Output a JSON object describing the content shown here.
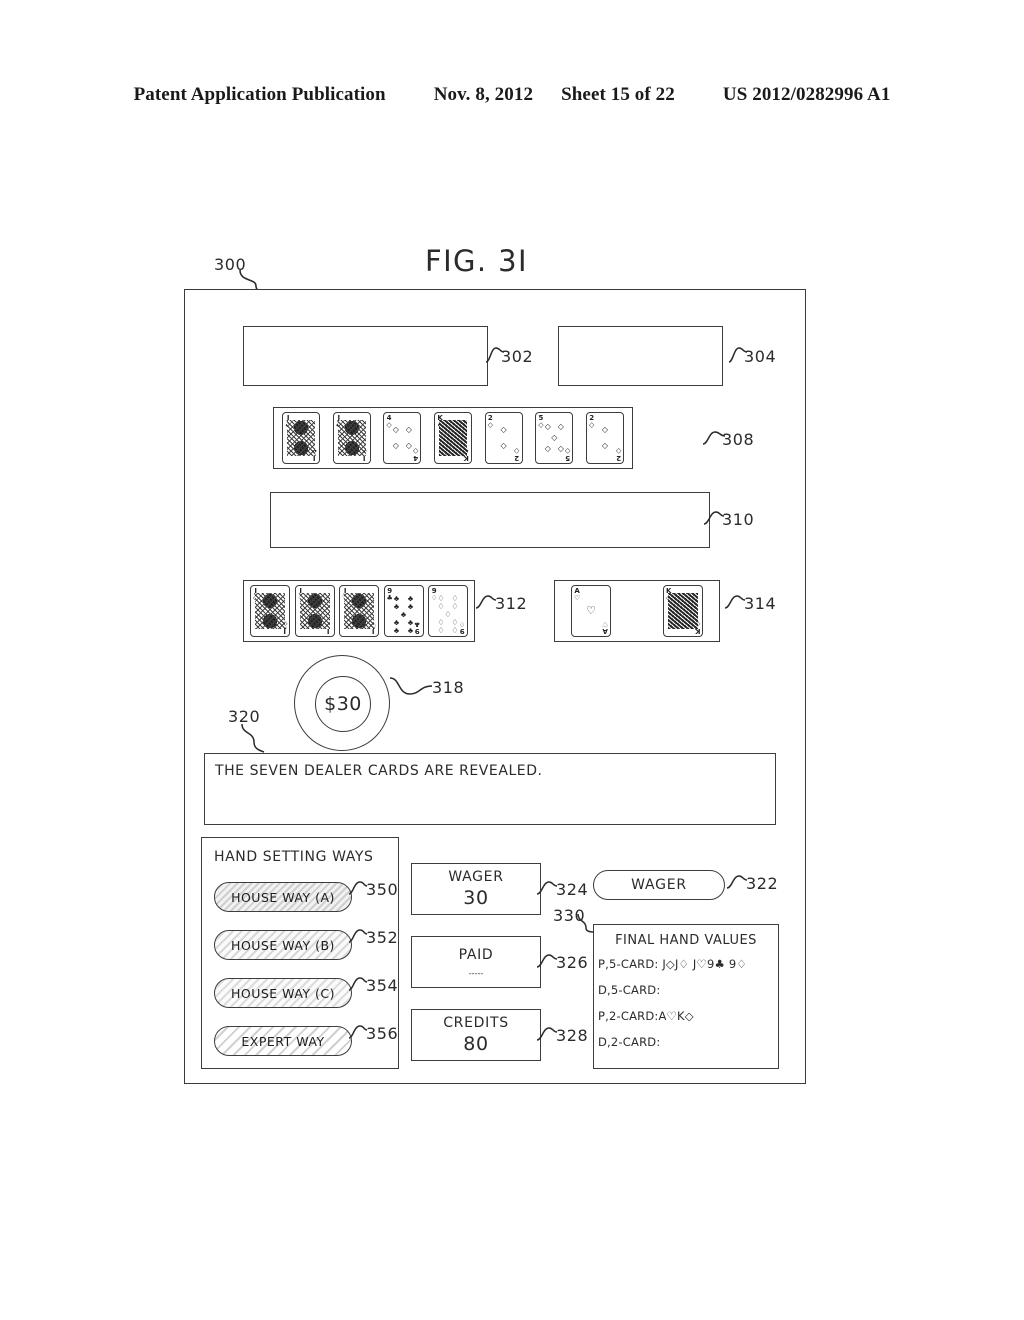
{
  "header": {
    "publication": "Patent Application Publication",
    "date": "Nov. 8, 2012",
    "sheet": "Sheet 15 of 22",
    "number": "US 2012/0282996 A1"
  },
  "figure": {
    "title": "FIG. 3I",
    "device_ref": "300"
  },
  "refs": {
    "top_left_box": "302",
    "top_right_box": "304",
    "dealer_card_row": "308",
    "mid_box": "310",
    "player_hand_row": "312",
    "player_two_card_row": "314",
    "bet_chip": "318",
    "message_box": "320",
    "wager_button": "322",
    "wager_meter": "324",
    "paid_meter": "326",
    "credits_meter": "328",
    "final_hand_values": "330",
    "house_way_a": "350",
    "house_way_b": "352",
    "house_way_c": "354",
    "expert_way": "356"
  },
  "chip": {
    "amount": "$30"
  },
  "message": {
    "text": "THE SEVEN DEALER CARDS ARE REVEALED."
  },
  "ways": {
    "title": "HAND SETTING WAYS",
    "buttons": [
      {
        "label": "HOUSE WAY (A)"
      },
      {
        "label": "HOUSE WAY (B)"
      },
      {
        "label": "HOUSE WAY (C)"
      },
      {
        "label": "EXPERT WAY"
      }
    ]
  },
  "meters": {
    "wager": {
      "label": "WAGER",
      "value": "30"
    },
    "paid": {
      "label": "PAID",
      "value": "-----"
    },
    "credits": {
      "label": "CREDITS",
      "value": "80"
    }
  },
  "wager_button": {
    "label": "WAGER"
  },
  "final_hand_values": {
    "title": "FINAL HAND VALUES",
    "rows": [
      "P,5-CARD: J◇J♢ J♡9♣ 9♢",
      "D,5-CARD:",
      "P,2-CARD:A♡K◇",
      "D,2-CARD:"
    ]
  },
  "card_rows": {
    "dealer_seven": [
      {
        "rank": "J",
        "suit": "♣",
        "type": "face",
        "dark": false
      },
      {
        "rank": "J",
        "suit": "♣",
        "type": "face",
        "dark": false
      },
      {
        "rank": "4",
        "suit": "◇",
        "type": "pip",
        "pips": 4
      },
      {
        "rank": "K",
        "suit": "♠",
        "type": "face",
        "dark": true
      },
      {
        "rank": "2",
        "suit": "◇",
        "type": "pip",
        "pips": 2
      },
      {
        "rank": "5",
        "suit": "◇",
        "type": "pip",
        "pips": 5
      },
      {
        "rank": "2",
        "suit": "◇",
        "type": "pip",
        "pips": 2
      }
    ],
    "player_five": [
      {
        "rank": "J",
        "suit": "◇",
        "type": "face",
        "dark": false
      },
      {
        "rank": "J",
        "suit": "♢",
        "type": "face",
        "dark": false
      },
      {
        "rank": "J",
        "suit": "♡",
        "type": "face",
        "dark": false
      },
      {
        "rank": "9",
        "suit": "♣",
        "type": "pip",
        "pips": 9
      },
      {
        "rank": "9",
        "suit": "♢",
        "type": "pip",
        "pips": 9
      }
    ],
    "player_two": [
      {
        "rank": "A",
        "suit": "♡",
        "type": "pip",
        "pips": 1
      },
      {
        "rank": "K",
        "suit": "◇",
        "type": "face",
        "dark": true
      }
    ]
  }
}
